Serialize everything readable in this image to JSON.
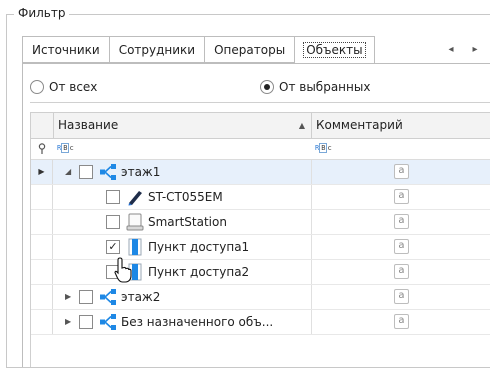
{
  "filter": {
    "title": "Фильтр"
  },
  "tabs": [
    {
      "label": "Источники"
    },
    {
      "label": "Сотрудники"
    },
    {
      "label": "Операторы"
    },
    {
      "label": "Объекты",
      "active": true
    }
  ],
  "tab_nav": {
    "prev": "◂",
    "next": "▸"
  },
  "radios": [
    {
      "label": "От всех",
      "selected": false
    },
    {
      "label": "От выбранных",
      "selected": true
    }
  ],
  "grid": {
    "columns": [
      {
        "label": "Название"
      },
      {
        "label": "Комментарий"
      }
    ],
    "filter_row_icon": "pin-icon",
    "note_glyph": "a",
    "rows": [
      {
        "name": "этаж1",
        "icon": "hierarchy-icon",
        "checked": false,
        "expanded": true,
        "selected": true
      },
      {
        "name": "ST-CT055EM",
        "icon": "pen-reader-icon",
        "checked": false
      },
      {
        "name": "SmartStation",
        "icon": "station-icon",
        "checked": false
      },
      {
        "name": "Пункт доступа1",
        "icon": "door-icon",
        "checked": true
      },
      {
        "name": "Пункт доступа2",
        "icon": "door-icon",
        "checked": false
      },
      {
        "name": "этаж2",
        "icon": "hierarchy-icon",
        "checked": false,
        "expanded": false
      },
      {
        "name": "Без назначенного объ...",
        "icon": "hierarchy-icon",
        "checked": false,
        "expanded": false
      }
    ]
  },
  "colors": {
    "accent": "#1e88e5",
    "selection": "#e7f0fb"
  }
}
